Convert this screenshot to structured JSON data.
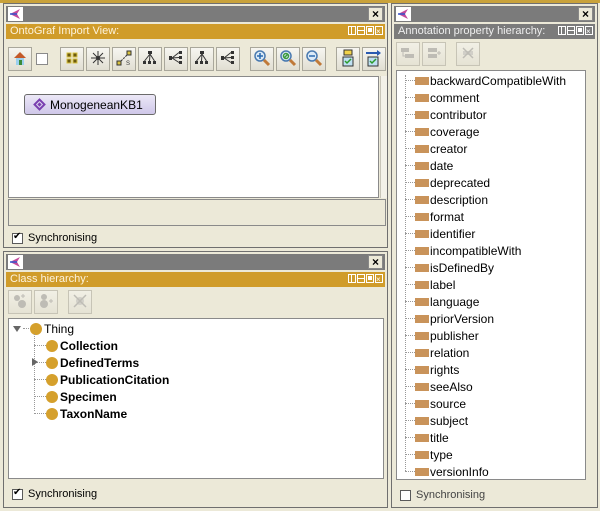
{
  "ontograf_panel": {
    "view_title": "OntoGraf Import View:",
    "toolbar": [
      {
        "name": "home-icon",
        "glyph": "home"
      },
      {
        "name": "grid-layout-icon",
        "glyph": "grid"
      },
      {
        "name": "radial-layout-icon",
        "glyph": "radial"
      },
      {
        "name": "spring-layout-icon",
        "glyph": "spring"
      },
      {
        "name": "tree-vertical-icon",
        "glyph": "treev"
      },
      {
        "name": "tree-horizontal-icon",
        "glyph": "treeh"
      },
      {
        "name": "tree-vertical-alt-icon",
        "glyph": "treev"
      },
      {
        "name": "tree-horizontal-alt-icon",
        "glyph": "treeh"
      },
      {
        "name": "zoom-in-icon",
        "glyph": "zoomin"
      },
      {
        "name": "zoom-reset-icon",
        "glyph": "zoomreset"
      },
      {
        "name": "zoom-out-icon",
        "glyph": "zoomout"
      },
      {
        "name": "filter-node-icon",
        "glyph": "filter"
      },
      {
        "name": "export-icon",
        "glyph": "export"
      }
    ],
    "node_label": "MonogeneanKB1",
    "sync_label": "Synchronising",
    "sync_checked": true
  },
  "class_panel": {
    "view_title": "Class hierarchy:",
    "root": "Thing",
    "children": [
      {
        "label": "Collection",
        "expandable": false
      },
      {
        "label": "DefinedTerms",
        "expandable": true
      },
      {
        "label": "PublicationCitation",
        "expandable": false
      },
      {
        "label": "Specimen",
        "expandable": false
      },
      {
        "label": "TaxonName",
        "expandable": false
      }
    ],
    "sync_label": "Synchronising",
    "sync_checked": true
  },
  "annotation_panel": {
    "view_title": "Annotation property hierarchy:",
    "properties": [
      "backwardCompatibleWith",
      "comment",
      "contributor",
      "coverage",
      "creator",
      "date",
      "deprecated",
      "description",
      "format",
      "identifier",
      "incompatibleWith",
      "isDefinedBy",
      "label",
      "language",
      "priorVersion",
      "publisher",
      "relation",
      "rights",
      "seeAlso",
      "source",
      "subject",
      "title",
      "type",
      "versionInfo"
    ],
    "sync_label": "Synchronising",
    "sync_checked": false
  },
  "colors": {
    "view_header": "#d09c2a",
    "class_dot": "#d5a02c",
    "property_bar": "#c9935a",
    "window_title": "#7b7b7b"
  }
}
